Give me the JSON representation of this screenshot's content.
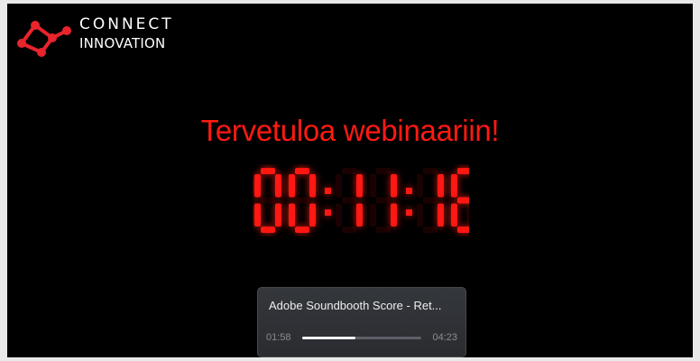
{
  "logo": {
    "line1": "CONNECT",
    "line2": "INNOVATION",
    "icon": "connect-network-icon",
    "accent_color": "#e8242c"
  },
  "heading": "Tervetuloa webinaariin!",
  "countdown": {
    "value": "00:11:16",
    "color": "#ff1712"
  },
  "player": {
    "track_title": "Adobe Soundbooth Score - Ret...",
    "current_time": "01:58",
    "total_time": "04:23",
    "progress": 0.45
  }
}
